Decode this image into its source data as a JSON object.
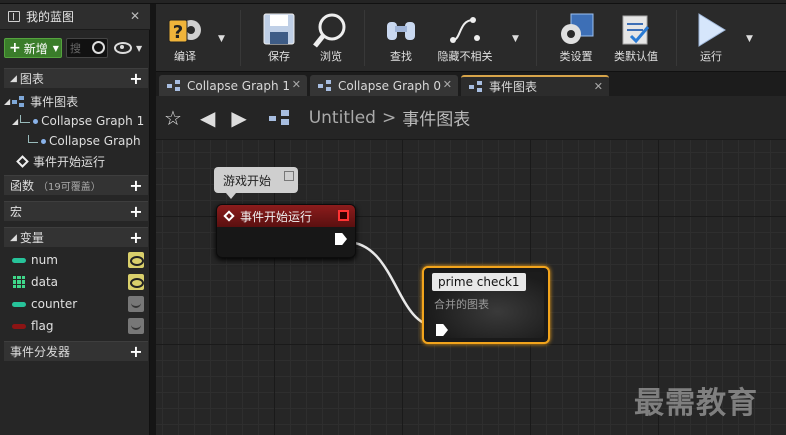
{
  "left_panel": {
    "title": "我的蓝图",
    "close": "✕",
    "new_button": "新增",
    "search_placeholder": "搜",
    "sections": {
      "graphs": "图表",
      "functions": "函数",
      "functions_note": "（19可覆盖）",
      "macros": "宏",
      "variables": "变量",
      "event_dispatchers": "事件分发器"
    },
    "tree": {
      "event_graph": "事件图表",
      "collapse_graph_1": "Collapse Graph 1",
      "collapse_graph": "Collapse Graph",
      "begin_play": "事件开始运行"
    },
    "variables": [
      {
        "name": "num",
        "type_color": "#27c39a",
        "visible": true
      },
      {
        "name": "data",
        "type_color": "#3fd78a",
        "visible": true
      },
      {
        "name": "counter",
        "type_color": "#27c39a",
        "visible": false
      },
      {
        "name": "flag",
        "type_color": "#8c1414",
        "visible": false
      }
    ]
  },
  "toolbar": {
    "compile": "编译",
    "save": "保存",
    "browse": "浏览",
    "find": "查找",
    "hide_unrelated": "隐藏不相关",
    "class_settings": "类设置",
    "class_defaults": "类默认值",
    "play": "运行"
  },
  "tabs": [
    {
      "label": "Collapse Graph 1",
      "close": "✕"
    },
    {
      "label": "Collapse Graph 0",
      "close": "✕"
    },
    {
      "label": "事件图表",
      "close": "✕"
    }
  ],
  "graph": {
    "breadcrumb_root": "Untitled",
    "breadcrumb_sep": ">",
    "breadcrumb_current": "事件图表",
    "comment": "游戏开始",
    "event_node_title": "事件开始运行",
    "collapsed_node_title": "prime check1",
    "collapsed_node_subtitle": "合并的图表"
  },
  "watermark": "最需教育",
  "colors": {
    "accent_selected": "#f2a41c",
    "event_header": "#8c1c1c",
    "new_button": "#3a7d2a"
  }
}
